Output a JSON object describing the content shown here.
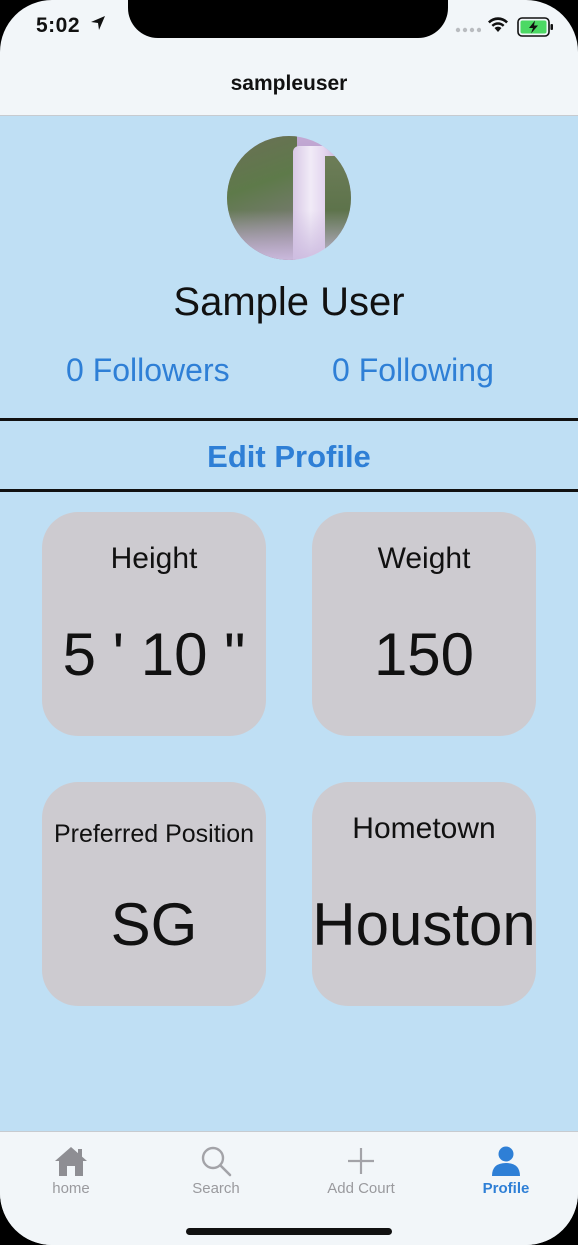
{
  "status": {
    "time": "5:02"
  },
  "nav": {
    "title": "sampleuser"
  },
  "profile": {
    "full_name": "Sample User",
    "followers": "0 Followers",
    "following": "0 Following",
    "edit_label": "Edit Profile"
  },
  "stats": [
    {
      "label": "Height",
      "value": "5 ' 10 \""
    },
    {
      "label": "Weight",
      "value": "150"
    },
    {
      "label": "Preferred Position",
      "value": "SG"
    },
    {
      "label": "Hometown",
      "value": "Houston"
    }
  ],
  "tabs": [
    {
      "label": "home",
      "icon": "house-icon"
    },
    {
      "label": "Search",
      "icon": "magnifier-icon"
    },
    {
      "label": "Add Court",
      "icon": "plus-icon"
    },
    {
      "label": "Profile",
      "icon": "person-icon",
      "active": true
    }
  ],
  "colors": {
    "accent": "#2e7fd6",
    "background": "#bfdff4",
    "card": "#cdcbd0"
  }
}
